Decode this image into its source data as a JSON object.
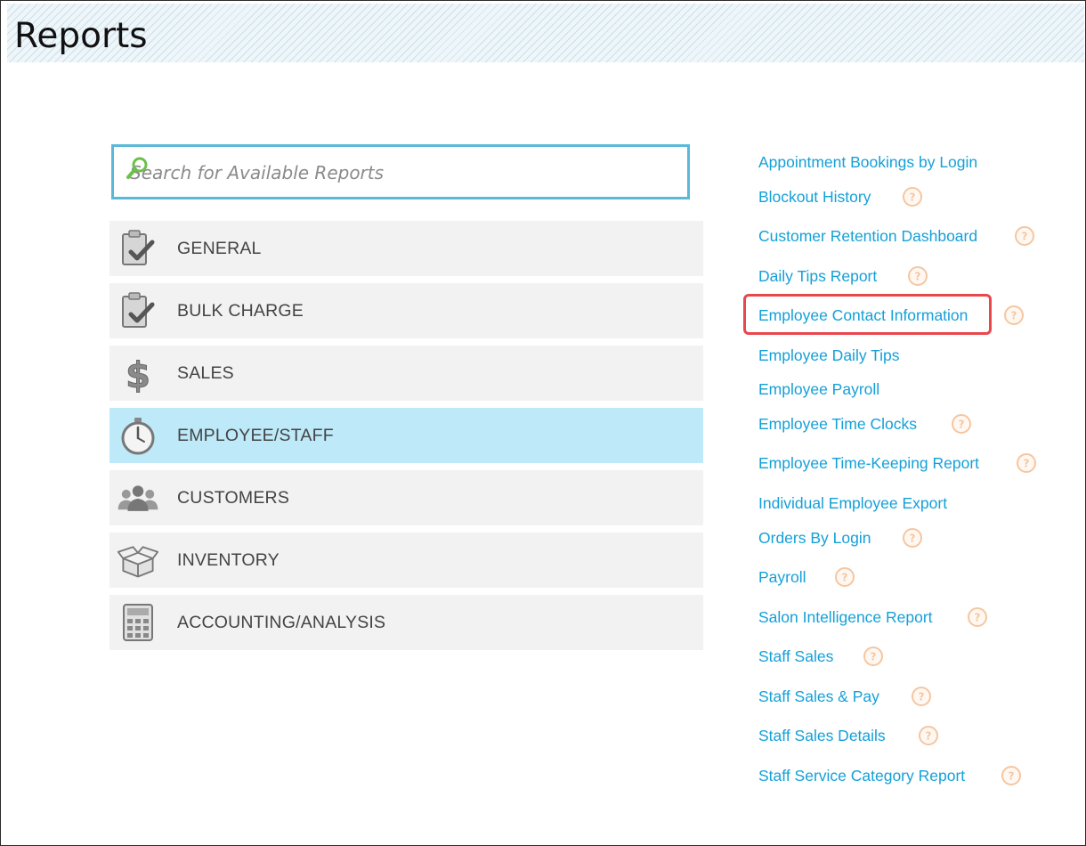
{
  "header": {
    "title": "Reports"
  },
  "search": {
    "placeholder": "Search for Available Reports"
  },
  "categories": [
    {
      "label": "GENERAL",
      "icon": "clipboard-check-icon"
    },
    {
      "label": "BULK CHARGE",
      "icon": "clipboard-check-icon"
    },
    {
      "label": "SALES",
      "icon": "dollar-icon"
    },
    {
      "label": "EMPLOYEE/STAFF",
      "icon": "stopwatch-icon",
      "active": true
    },
    {
      "label": "CUSTOMERS",
      "icon": "people-icon"
    },
    {
      "label": "INVENTORY",
      "icon": "open-box-icon"
    },
    {
      "label": "ACCOUNTING/ANALYSIS",
      "icon": "calculator-icon"
    }
  ],
  "reports": [
    {
      "label": "Appointment Bookings by Login",
      "help": false
    },
    {
      "label": "Blockout History",
      "help": true
    },
    {
      "label": "Customer Retention Dashboard",
      "help": true
    },
    {
      "label": "Daily Tips Report",
      "help": true
    },
    {
      "label": "Employee Contact Information",
      "help": true,
      "highlighted": true
    },
    {
      "label": "Employee Daily Tips",
      "help": false
    },
    {
      "label": "Employee Payroll",
      "help": false
    },
    {
      "label": "Employee Time Clocks",
      "help": true
    },
    {
      "label": "Employee Time-Keeping Report",
      "help": true
    },
    {
      "label": "Individual Employee Export",
      "help": false
    },
    {
      "label": "Orders By Login",
      "help": true
    },
    {
      "label": "Payroll",
      "help": true
    },
    {
      "label": "Salon Intelligence Report",
      "help": true
    },
    {
      "label": "Staff Sales",
      "help": true
    },
    {
      "label": "Staff Sales & Pay",
      "help": true
    },
    {
      "label": "Staff Sales Details",
      "help": true
    },
    {
      "label": "Staff Service Category Report",
      "help": true
    }
  ],
  "colors": {
    "link": "#14a0d8",
    "active_category": "#bde9f9",
    "category_bg": "#f2f2f2",
    "search_border": "#5bb8d8",
    "highlight": "#e8474c",
    "help_icon": "#f5c6a0"
  }
}
